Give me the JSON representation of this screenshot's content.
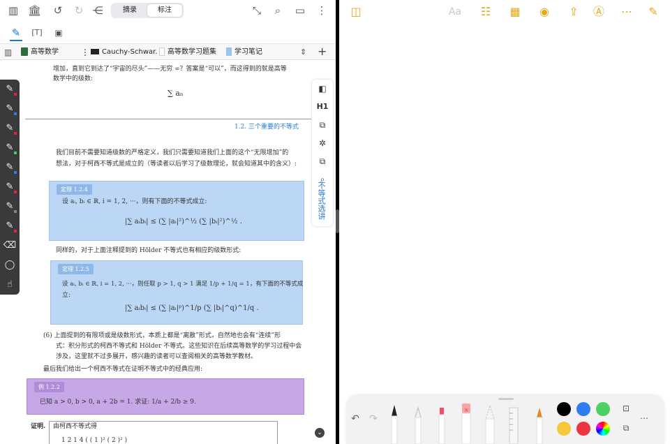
{
  "left_app": {
    "segment": {
      "excerpt": "摘录",
      "annotate": "标注"
    },
    "tabs": [
      {
        "label": "高等数学"
      },
      {
        "label": "Cauchy-Schwar..."
      },
      {
        "label": "高等数学习题集"
      },
      {
        "label": "学习笔记"
      }
    ],
    "content": {
      "line1": "增加，直到它到达了“宇宙的尽头”——无穷 ∞？答案是“可以”，而这得到的就是高等",
      "line2": "数学中的级数:",
      "sum_formula": "∑ aₙ",
      "section_head": "1.2.  三个重要的不等式",
      "para1a": "我们目前不需要知道级数的严格定义，我们只需要知道我们上面的这个“无限增加”的",
      "para1b": "想法，对于柯西不等式是成立的（等读者以后学习了级数理论，就会知道其中的含义）:",
      "thm1_label": "定理 1.2.4",
      "thm1_text": "设 aᵢ, bᵢ ∈ ℝ, i = 1, 2, ···，则有下面的不等式成立:",
      "thm1_formula": "|∑ aᵢbᵢ| ≤ (∑ |aᵢ|²)^½ (∑ |bᵢ|²)^½ .",
      "mid_text": "同样的，对于上面注释提到的 Hölder 不等式也有相应的级数形式:",
      "thm2_label": "定理 1.2.5",
      "thm2_text1": "设 aᵢ, bᵢ ∈ ℝ, i = 1, 2, ···，则任取 p > 1, q > 1 满足  1/p + 1/q = 1，有下面的不等式成",
      "thm2_text2": "立:",
      "thm2_formula": "|∑ aᵢbᵢ| ≤ (∑ |aᵢ|ᵖ)^1/p (∑ |bᵢ|^q)^1/q .",
      "note_a": "(6)  上面提到的有限项或是级数形式，本质上都是“离散”形式，自然地也会有“连续”形",
      "note_b": "式：积分形式的柯西不等式和 Hölder 不等式。这些知识在后续高等数学的学习过程中会",
      "note_c": "涉及，这里就不过多展开，感兴趣的读者可以查阅相关的高等数学教材。",
      "last_line": "最后我们给出一个柯西不等式在证明不等式中的经典应用:",
      "ex_label": "例 1.2.2",
      "ex_text": "已知 a > 0, b > 0, a + 2b = 1. 求证:  1/a + 2/b ≥ 9.",
      "proof_label": "证明.",
      "proof_text": "由柯西不等式得",
      "proof_bottom": "1    2     1    4          ( ( 1 )²     ( 2 )² )"
    },
    "vertical_tab": "不等式选讲",
    "right_toolbar_heading": "H1"
  },
  "right_app": {
    "aa_label": "Aa"
  },
  "colors": {
    "theorem_bg": "#bcd7f5",
    "example_bg": "#c6a8e6",
    "notes_accent": "#e3a91c",
    "swatches": [
      "#000000",
      "#2f7ef0",
      "#4cd05f",
      "#f5c83a",
      "#ee3440"
    ]
  }
}
